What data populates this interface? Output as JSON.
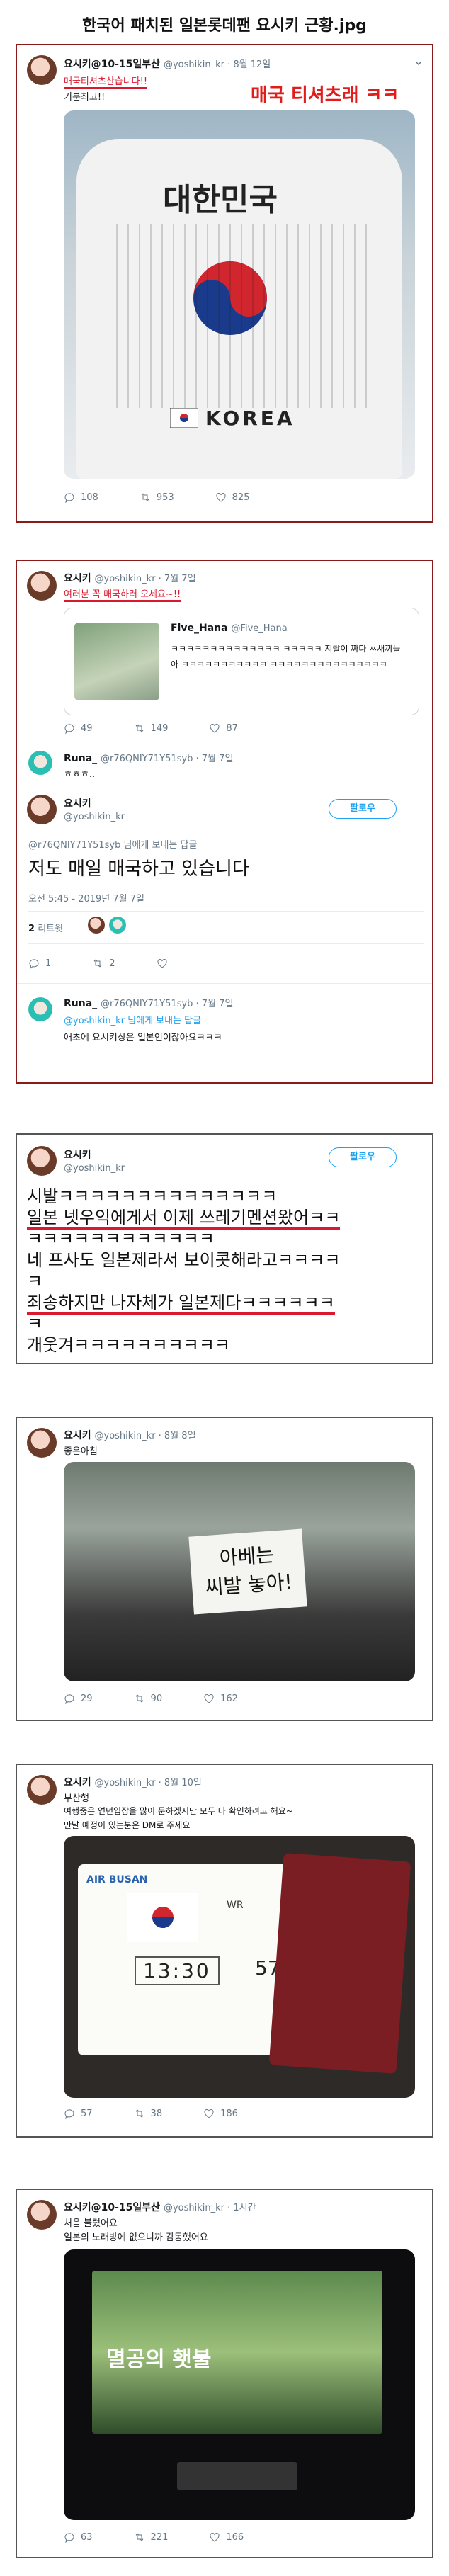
{
  "page": {
    "title": "한국어 패치된 일본롯데팬 요시키 근황.jpg"
  },
  "post1": {
    "name": "요시키@10-15일부산",
    "handle": "@yoshikin_kr · 8월 12일",
    "line1": "매국티셔츠산습니다!!",
    "line2": "기분최고!!",
    "overlay": "매국 티셔츠래 ㅋㅋ",
    "shirt_title": "대한민국",
    "shirt_footer": "KOREA",
    "replies": "108",
    "retweets": "953",
    "likes": "825"
  },
  "post2": {
    "name": "요시키",
    "handle": "@yoshikin_kr · 7월 7일",
    "text": "여러분 꼭 매국하러 오세요~!!",
    "quote_name": "Five_Hana",
    "quote_handle": "@Five_Hana",
    "quote_text": "ㅋㅋㅋㅋㅋㅋㅋㅋㅋㅋㅋㅋㅋㅋ ㅋㅋㅋㅋㅋ 지랄이 짜다 ㅆ새끼들아 ㅋㅋㅋㅋㅋㅋㅋㅋㅋㅋㅋ ㅋㅋㅋㅋㅋㅋㅋㅋㅋㅋㅋㅋㅋㅋㅋ",
    "replies": "49",
    "retweets": "149",
    "likes": "87",
    "reply_name": "Runa_",
    "reply_handle": "@r76QNIY71Y51syb · 7월 7일",
    "reply_text": "ㅎㅎㅎ..",
    "main_name": "요시키",
    "main_handle": "@yoshikin_kr",
    "follow": "팔로우",
    "replying_to": "@r76QNIY71Y51syb 님에게 보내는 답글",
    "main_text": "저도 매일 매국하고 있습니다",
    "time": "오전 5:45 - 2019년 7월 7일",
    "retweet_count": "2",
    "retweet_label": "리트윗",
    "action_reply": "1",
    "action_retweet": "2",
    "runa2_name": "Runa_",
    "runa2_handle": "@r76QNIY71Y51syb · 7월 7일",
    "runa2_reply_to": "@yoshikin_kr 님에게 보내는 답글",
    "runa2_text": "애초에 요시키상은 일본인이잖아요ㅋㅋㅋ"
  },
  "post3": {
    "name": "요시키",
    "handle": "@yoshikin_kr",
    "follow": "팔로우",
    "lines": [
      "시발ㅋㅋㅋㅋㅋㅋㅋㅋㅋㅋㅋㅋㅋㅋ",
      "일본 넷우익에게서 이제 쓰레기멘션왔어ㅋㅋ",
      "ㅋㅋㅋㅋㅋㅋㅋㅋㅋㅋㅋㅋ",
      "네 프사도 일본제라서 보이콧해라고ㅋㅋㅋㅋ",
      "ㅋ",
      "죄송하지만 나자체가 일본제다ㅋㅋㅋㅋㅋㅋ",
      "ㅋ",
      "개웃겨ㅋㅋㅋㅋㅋㅋㅋㅋㅋㅋ"
    ]
  },
  "post4": {
    "name": "요시키",
    "handle": "@yoshikin_kr · 8월 8일",
    "text": "좋은아침",
    "sign_line1": "아베는",
    "sign_line2": "씨발 놓아!",
    "replies": "29",
    "retweets": "90",
    "likes": "162"
  },
  "post5": {
    "name": "요시키",
    "handle": "@yoshikin_kr · 8월 10일",
    "line1": "부산행",
    "line2": "여행중은 연년입장을 많이 문하겠지만 모두 다 확인하려고 해요~",
    "line3": "만날 예정이 있는분은 DM로 주세요",
    "ticket_brand": "AIR BUSAN",
    "ticket_code": "WR",
    "ticket_time": "13:30",
    "ticket_gate": "57",
    "replies": "57",
    "retweets": "38",
    "likes": "186"
  },
  "post6": {
    "name": "요시키@10-15일부산",
    "handle": "@yoshikin_kr · 1시간",
    "line1": "처음 불렀어요",
    "line2": "일본의 노래방에 없으니까 감동했어요",
    "screen_title": "멸공의 횃불",
    "replies": "63",
    "retweets": "221",
    "likes": "166"
  },
  "colors": {
    "accent": "#1da1f2",
    "highlight": "#d8192e"
  }
}
